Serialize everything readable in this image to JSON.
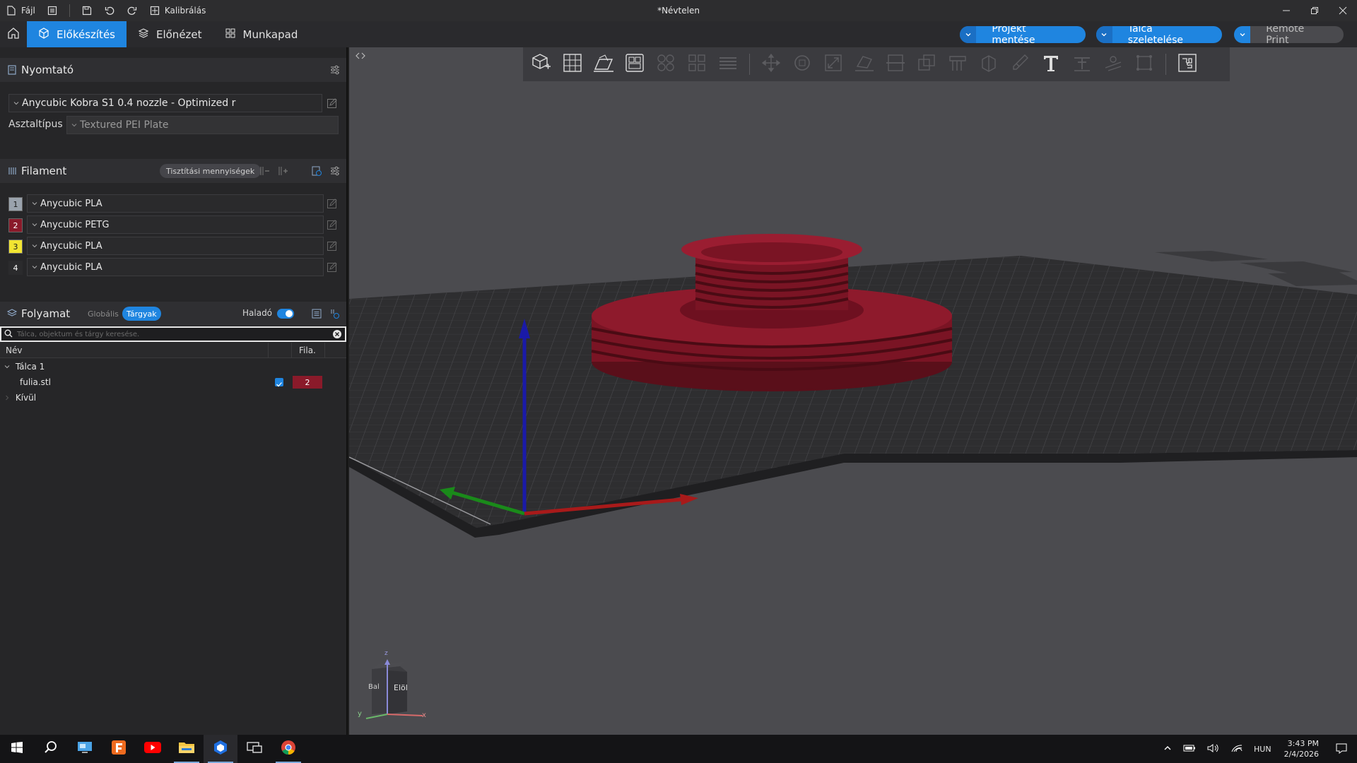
{
  "titlebar": {
    "file_label": "Fájl",
    "calibration_label": "Kalibrálás",
    "window_title": "*Névtelen"
  },
  "tabs": {
    "prepare": "Előkészítés",
    "preview": "Előnézet",
    "workspace": "Munkapad"
  },
  "actions": {
    "save_project": "Projekt mentése",
    "slice_plate": "Tálca szeletelése",
    "remote_print": "Remote Print"
  },
  "printer": {
    "section_title": "Nyomtató",
    "preset": "Anycubic Kobra S1 0.4 nozzle - Optimized r",
    "bed_type_label": "Asztaltípus",
    "bed_type_value": "Textured PEI Plate"
  },
  "filament": {
    "section_title": "Filament",
    "flush_button": "Tisztítási mennyiségek",
    "slots": [
      {
        "num": "1",
        "name": "Anycubic PLA",
        "color": "#9aa3ad",
        "text_color": "#1a1a1a"
      },
      {
        "num": "2",
        "name": "Anycubic PETG",
        "color": "#8a1a2a",
        "text_color": "#ffffff"
      },
      {
        "num": "3",
        "name": "Anycubic PLA",
        "color": "#f2e532",
        "text_color": "#1a1a1a"
      },
      {
        "num": "4",
        "name": "Anycubic PLA",
        "color": "#2b2b2d",
        "text_color": "#ffffff"
      }
    ]
  },
  "process": {
    "section_title": "Folyamat",
    "global_label": "Globális",
    "objects_label": "Tárgyak",
    "advanced_label": "Haladó",
    "search_placeholder": "Tálca, objektum és tárgy keresése.",
    "col_name": "Név",
    "col_filament": "Fila.",
    "plate_label": "Tálca 1",
    "object_name": "fulia.stl",
    "object_filament": "2",
    "outside_label": "Kívül"
  },
  "viewcube": {
    "left_label": "Bal",
    "front_label": "Elöl",
    "axis_x": "x",
    "axis_y": "y",
    "axis_z": "z"
  },
  "taskbar": {
    "language": "HUN",
    "time": "3:43 PM",
    "date": "2/4/2026"
  },
  "colors": {
    "accent": "#1f85e0",
    "model": "#8a1a2a",
    "viewport_bg": "#4b4b4f",
    "bed": "#2e2e30"
  }
}
